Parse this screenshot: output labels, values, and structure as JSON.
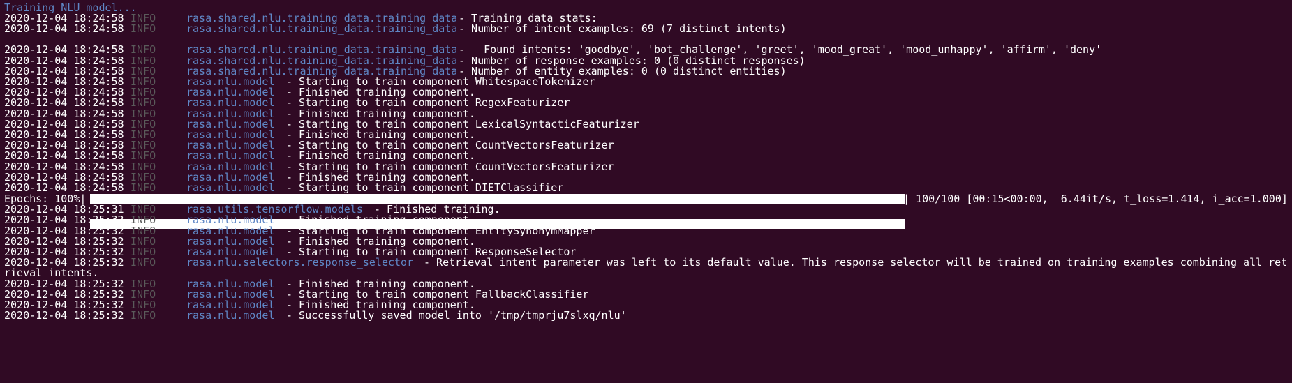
{
  "header": {
    "text": "Training NLU model..."
  },
  "lines": [
    {
      "ts": "2020-12-04 18:24:58",
      "level": "INFO",
      "logger": "rasa.shared.nlu.training_data.training_data",
      "message": "- Training data stats:"
    },
    {
      "ts": "2020-12-04 18:24:58",
      "level": "INFO",
      "logger": "rasa.shared.nlu.training_data.training_data",
      "message": "- Number of intent examples: 69 (7 distinct intents)"
    },
    {
      "ts": "2020-12-04 18:24:58",
      "level": "INFO",
      "logger": "rasa.shared.nlu.training_data.training_data",
      "message": "-   Found intents: 'goodbye', 'bot_challenge', 'greet', 'mood_great', 'mood_unhappy', 'affirm', 'deny'"
    },
    {
      "ts": "2020-12-04 18:24:58",
      "level": "INFO",
      "logger": "rasa.shared.nlu.training_data.training_data",
      "message": "- Number of response examples: 0 (0 distinct responses)"
    },
    {
      "ts": "2020-12-04 18:24:58",
      "level": "INFO",
      "logger": "rasa.shared.nlu.training_data.training_data",
      "message": "- Number of entity examples: 0 (0 distinct entities)"
    },
    {
      "ts": "2020-12-04 18:24:58",
      "level": "INFO",
      "logger": "rasa.nlu.model",
      "message": "- Starting to train component WhitespaceTokenizer"
    },
    {
      "ts": "2020-12-04 18:24:58",
      "level": "INFO",
      "logger": "rasa.nlu.model",
      "message": "- Finished training component."
    },
    {
      "ts": "2020-12-04 18:24:58",
      "level": "INFO",
      "logger": "rasa.nlu.model",
      "message": "- Starting to train component RegexFeaturizer"
    },
    {
      "ts": "2020-12-04 18:24:58",
      "level": "INFO",
      "logger": "rasa.nlu.model",
      "message": "- Finished training component."
    },
    {
      "ts": "2020-12-04 18:24:58",
      "level": "INFO",
      "logger": "rasa.nlu.model",
      "message": "- Starting to train component LexicalSyntacticFeaturizer"
    },
    {
      "ts": "2020-12-04 18:24:58",
      "level": "INFO",
      "logger": "rasa.nlu.model",
      "message": "- Finished training component."
    },
    {
      "ts": "2020-12-04 18:24:58",
      "level": "INFO",
      "logger": "rasa.nlu.model",
      "message": "- Starting to train component CountVectorsFeaturizer"
    },
    {
      "ts": "2020-12-04 18:24:58",
      "level": "INFO",
      "logger": "rasa.nlu.model",
      "message": "- Finished training component."
    },
    {
      "ts": "2020-12-04 18:24:58",
      "level": "INFO",
      "logger": "rasa.nlu.model",
      "message": "- Starting to train component CountVectorsFeaturizer"
    },
    {
      "ts": "2020-12-04 18:24:58",
      "level": "INFO",
      "logger": "rasa.nlu.model",
      "message": "- Finished training component."
    },
    {
      "ts": "2020-12-04 18:24:58",
      "level": "INFO",
      "logger": "rasa.nlu.model",
      "message": "- Starting to train component DIETClassifier"
    },
    {
      "ts": "2020-12-04 18:25:31",
      "level": "INFO",
      "logger": "rasa.utils.tensorflow.models",
      "message": "- Finished training."
    },
    {
      "ts": "2020-12-04 18:25:32",
      "level": "INFO",
      "logger": "rasa.nlu.model",
      "message": "- Finished training component."
    },
    {
      "ts": "2020-12-04 18:25:32",
      "level": "INFO",
      "logger": "rasa.nlu.model",
      "message": "- Starting to train component EntitySynonymMapper"
    },
    {
      "ts": "2020-12-04 18:25:32",
      "level": "INFO",
      "logger": "rasa.nlu.model",
      "message": "- Finished training component."
    },
    {
      "ts": "2020-12-04 18:25:32",
      "level": "INFO",
      "logger": "rasa.nlu.model",
      "message": "- Starting to train component ResponseSelector"
    },
    {
      "ts": "2020-12-04 18:25:32",
      "level": "INFO",
      "logger": "rasa.nlu.selectors.response_selector",
      "message": "- Retrieval intent parameter was left to its default value. This response selector will be trained on training examples combining all ret"
    },
    {
      "ts": "2020-12-04 18:25:32",
      "level": "INFO",
      "logger": "rasa.nlu.model",
      "message": "- Finished training component."
    },
    {
      "ts": "2020-12-04 18:25:32",
      "level": "INFO",
      "logger": "rasa.nlu.model",
      "message": "- Starting to train component FallbackClassifier"
    },
    {
      "ts": "2020-12-04 18:25:32",
      "level": "INFO",
      "logger": "rasa.nlu.model",
      "message": "- Finished training component."
    },
    {
      "ts": "2020-12-04 18:25:32",
      "level": "INFO",
      "logger": "rasa.nlu.model",
      "message": "- Successfully saved model into '/tmp/tmprju7slxq/nlu'"
    }
  ],
  "wrap": {
    "text": "rieval intents."
  },
  "progress": {
    "label": "Epochs: 100%|",
    "percent": 100,
    "suffix": "| 100/100 [00:15<00:00,  6.44it/s, t_loss=1.414, i_acc=1.000]"
  },
  "colors": {
    "background": "#300a24",
    "text": "#ffffff",
    "level": "#5a5a5a",
    "logger": "#5f87c6"
  }
}
